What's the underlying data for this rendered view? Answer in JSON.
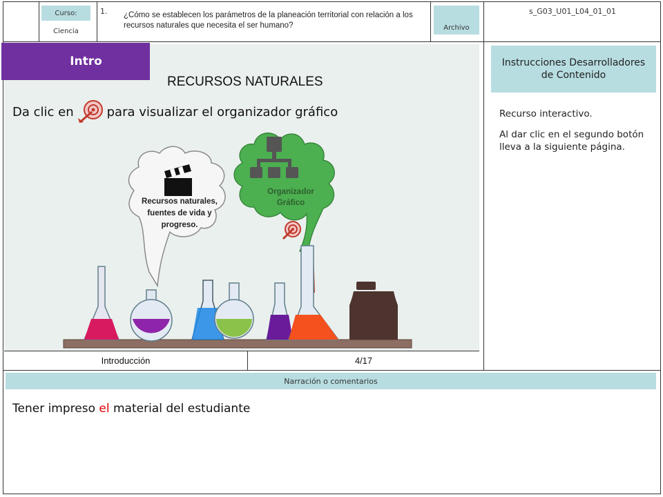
{
  "header": {
    "course_label": "Curso:",
    "course_value": "Ciencia",
    "item_number": "1.",
    "question": "¿Cómo se establecen los parámetros de la planeación territorial con relación a los recursos naturales que necesita el ser humano?",
    "file_label": "Archivo",
    "file_code": "s_G03_U01_L04_01_01"
  },
  "slide": {
    "intro_label": "Intro",
    "title": "RECURSOS NATURALES",
    "instruction_before": "Da clic en",
    "instruction_after": "para visualizar el organizador gráfico",
    "video_bubble_text": "Recursos naturales, fuentes de vida y progreso.",
    "organizer_bubble_text": "Organizador Gráfico",
    "footer_left": "Introducción",
    "footer_right": "4/17"
  },
  "sidebar": {
    "header": "Instrucciones Desarrolladores de Contenido",
    "text1": "Recurso interactivo.",
    "text2": "Al dar clic en el segundo botón lleva a la siguiente página."
  },
  "narration": {
    "header": "Narración o comentarios",
    "text_before": "Tener impreso ",
    "text_highlight": "el",
    "text_after": " material del estudiante"
  },
  "colors": {
    "intro_purple": "#7030a0",
    "teal": "#b7dde1",
    "highlight_red": "#e00000",
    "bubble_green": "#4caf50"
  }
}
